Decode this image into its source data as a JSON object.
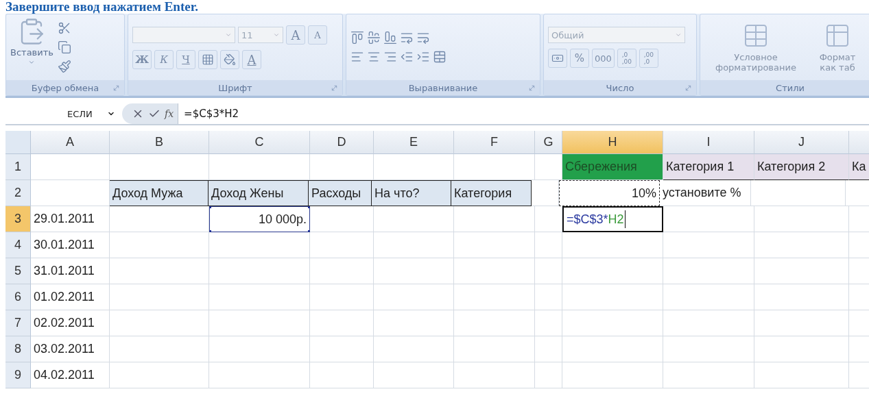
{
  "instruction": "Завершите ввод нажатием Enter.",
  "ribbon": {
    "groups": [
      {
        "kind": "clipboard",
        "label": "Буфер обмена",
        "launcher": true,
        "paste_label": "Вставить"
      },
      {
        "kind": "font",
        "label": "Шрифт",
        "launcher": true,
        "font_size": "11",
        "grow": "A",
        "shrink": "A",
        "styles": [
          "Ж",
          "К",
          "Ч"
        ],
        "font_color": "A"
      },
      {
        "kind": "alignment",
        "label": "Выравнивание",
        "launcher": true
      },
      {
        "kind": "number",
        "label": "Число",
        "launcher": true,
        "format": "Общий",
        "percent": "%",
        "thousands": "000",
        "decimals_more": [
          ",0",
          ",00"
        ],
        "decimals_less": [
          ",00",
          ",0"
        ]
      },
      {
        "kind": "styles",
        "label": "Стили",
        "buttons": [
          "Условное форматирование",
          "Формат как таб"
        ]
      }
    ]
  },
  "formula_bar": {
    "name_box": "ЕСЛИ",
    "fx": "fx",
    "formula": "=$C$3*H2"
  },
  "sheet": {
    "columns": [
      {
        "label": "A",
        "selected": false
      },
      {
        "label": "B",
        "selected": false
      },
      {
        "label": "C",
        "selected": false
      },
      {
        "label": "D",
        "selected": false
      },
      {
        "label": "E",
        "selected": false
      },
      {
        "label": "F",
        "selected": false
      },
      {
        "label": "G",
        "selected": false
      },
      {
        "label": "H",
        "selected": true
      },
      {
        "label": "I",
        "selected": false
      },
      {
        "label": "J",
        "selected": false
      },
      {
        "selected": false
      }
    ],
    "rows": [
      {
        "number": "1",
        "selected": false,
        "cells": [
          {
            "kind": "empty"
          },
          {
            "kind": "empty"
          },
          {
            "kind": "empty"
          },
          {
            "kind": "empty"
          },
          {
            "kind": "empty"
          },
          {
            "kind": "empty"
          },
          {
            "kind": "empty"
          },
          {
            "kind": "green-header",
            "text": "Сбережения"
          },
          {
            "kind": "lavender-header",
            "text": "Категория 1"
          },
          {
            "kind": "lavender-header",
            "text": "Категория 2"
          },
          {
            "kind": "lavender-header",
            "text": "Ка"
          }
        ]
      },
      {
        "number": "2",
        "selected": false,
        "cells": [
          {
            "kind": "empty"
          },
          {
            "kind": "table-header",
            "text": "Доход Мужа"
          },
          {
            "kind": "table-header",
            "text": "Доход Жены"
          },
          {
            "kind": "table-header",
            "text": "Расходы"
          },
          {
            "kind": "table-header",
            "text": "На что?"
          },
          {
            "kind": "table-header",
            "text": "Категория"
          },
          {
            "kind": "empty"
          },
          {
            "kind": "ref-dashed",
            "text": "10%"
          },
          {
            "kind": "text",
            "text": "установите %"
          },
          {
            "kind": "empty"
          },
          {
            "kind": "empty"
          }
        ]
      },
      {
        "number": "3",
        "selected": true,
        "cells": [
          {
            "kind": "text",
            "text": "29.01.2011"
          },
          {
            "kind": "empty"
          },
          {
            "kind": "ref-handles",
            "text": "10 000р."
          },
          {
            "kind": "empty"
          },
          {
            "kind": "empty"
          },
          {
            "kind": "empty"
          },
          {
            "kind": "empty"
          },
          {
            "kind": "editing",
            "parts": [
              {
                "text": "=$C$3*",
                "color": "#2b3aa0"
              },
              {
                "text": "H2",
                "color": "#3a9a3a"
              }
            ]
          },
          {
            "kind": "empty"
          },
          {
            "kind": "empty"
          },
          {
            "kind": "empty"
          }
        ]
      },
      {
        "number": "4",
        "selected": false,
        "cells": [
          {
            "kind": "text",
            "text": "30.01.2011"
          },
          {
            "kind": "empty"
          },
          {
            "kind": "empty"
          },
          {
            "kind": "empty"
          },
          {
            "kind": "empty"
          },
          {
            "kind": "empty"
          },
          {
            "kind": "empty"
          },
          {
            "kind": "empty"
          },
          {
            "kind": "empty"
          },
          {
            "kind": "empty"
          },
          {
            "kind": "empty"
          }
        ]
      },
      {
        "number": "5",
        "selected": false,
        "cells": [
          {
            "kind": "text",
            "text": "31.01.2011"
          },
          {
            "kind": "empty"
          },
          {
            "kind": "empty"
          },
          {
            "kind": "empty"
          },
          {
            "kind": "empty"
          },
          {
            "kind": "empty"
          },
          {
            "kind": "empty"
          },
          {
            "kind": "empty"
          },
          {
            "kind": "empty"
          },
          {
            "kind": "empty"
          },
          {
            "kind": "empty"
          }
        ]
      },
      {
        "number": "6",
        "selected": false,
        "cells": [
          {
            "kind": "text",
            "text": "01.02.2011"
          },
          {
            "kind": "empty"
          },
          {
            "kind": "empty"
          },
          {
            "kind": "empty"
          },
          {
            "kind": "empty"
          },
          {
            "kind": "empty"
          },
          {
            "kind": "empty"
          },
          {
            "kind": "empty"
          },
          {
            "kind": "empty"
          },
          {
            "kind": "empty"
          },
          {
            "kind": "empty"
          }
        ]
      },
      {
        "number": "7",
        "selected": false,
        "cells": [
          {
            "kind": "text",
            "text": "02.02.2011"
          },
          {
            "kind": "empty"
          },
          {
            "kind": "empty"
          },
          {
            "kind": "empty"
          },
          {
            "kind": "empty"
          },
          {
            "kind": "empty"
          },
          {
            "kind": "empty"
          },
          {
            "kind": "empty"
          },
          {
            "kind": "empty"
          },
          {
            "kind": "empty"
          },
          {
            "kind": "empty"
          }
        ]
      },
      {
        "number": "8",
        "selected": false,
        "cells": [
          {
            "kind": "text",
            "text": "03.02.2011"
          },
          {
            "kind": "empty"
          },
          {
            "kind": "empty"
          },
          {
            "kind": "empty"
          },
          {
            "kind": "empty"
          },
          {
            "kind": "empty"
          },
          {
            "kind": "empty"
          },
          {
            "kind": "empty"
          },
          {
            "kind": "empty"
          },
          {
            "kind": "empty"
          },
          {
            "kind": "empty"
          }
        ]
      },
      {
        "number": "9",
        "selected": false,
        "cells": [
          {
            "kind": "text",
            "text": "04.02.2011"
          },
          {
            "kind": "empty"
          },
          {
            "kind": "empty"
          },
          {
            "kind": "empty"
          },
          {
            "kind": "empty"
          },
          {
            "kind": "empty"
          },
          {
            "kind": "empty"
          },
          {
            "kind": "empty"
          },
          {
            "kind": "empty"
          },
          {
            "kind": "empty"
          },
          {
            "kind": "empty"
          }
        ]
      }
    ]
  }
}
